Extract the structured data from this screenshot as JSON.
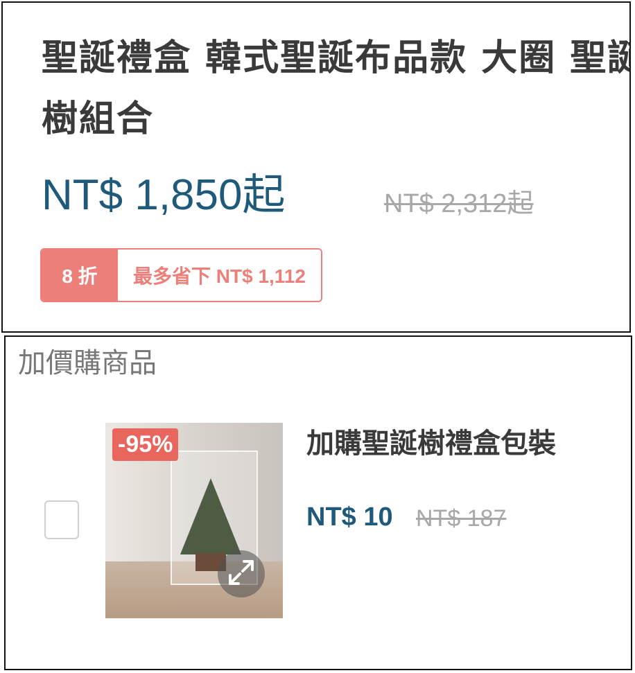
{
  "product": {
    "title": "聖誕禮盒 韓式聖誕布品款 大 圈 聖誕樹組合",
    "title_display": "聖誕禮盒 韓式聖誕布品款 大圈 聖誕樹組合",
    "price": "NT$ 1,850起",
    "original_price": "NT$ 2,312起",
    "discount_label": "8 折",
    "save_label": "最多省下 NT$ 1,112"
  },
  "addons": {
    "section_title": "加價購商品",
    "items": [
      {
        "name": "加購聖誕樹禮盒包裝",
        "price": "NT$ 10",
        "original_price": "NT$ 187",
        "discount_tag": "-95%",
        "checked": false
      }
    ]
  },
  "colors": {
    "price_blue": "#1f5a7a",
    "discount_red": "#ec7f7a",
    "tag_red": "#e8665e",
    "muted_gray": "#a8a8a8"
  },
  "icons": {
    "expand": "expand-arrows-icon",
    "checkbox": "checkbox-icon"
  }
}
